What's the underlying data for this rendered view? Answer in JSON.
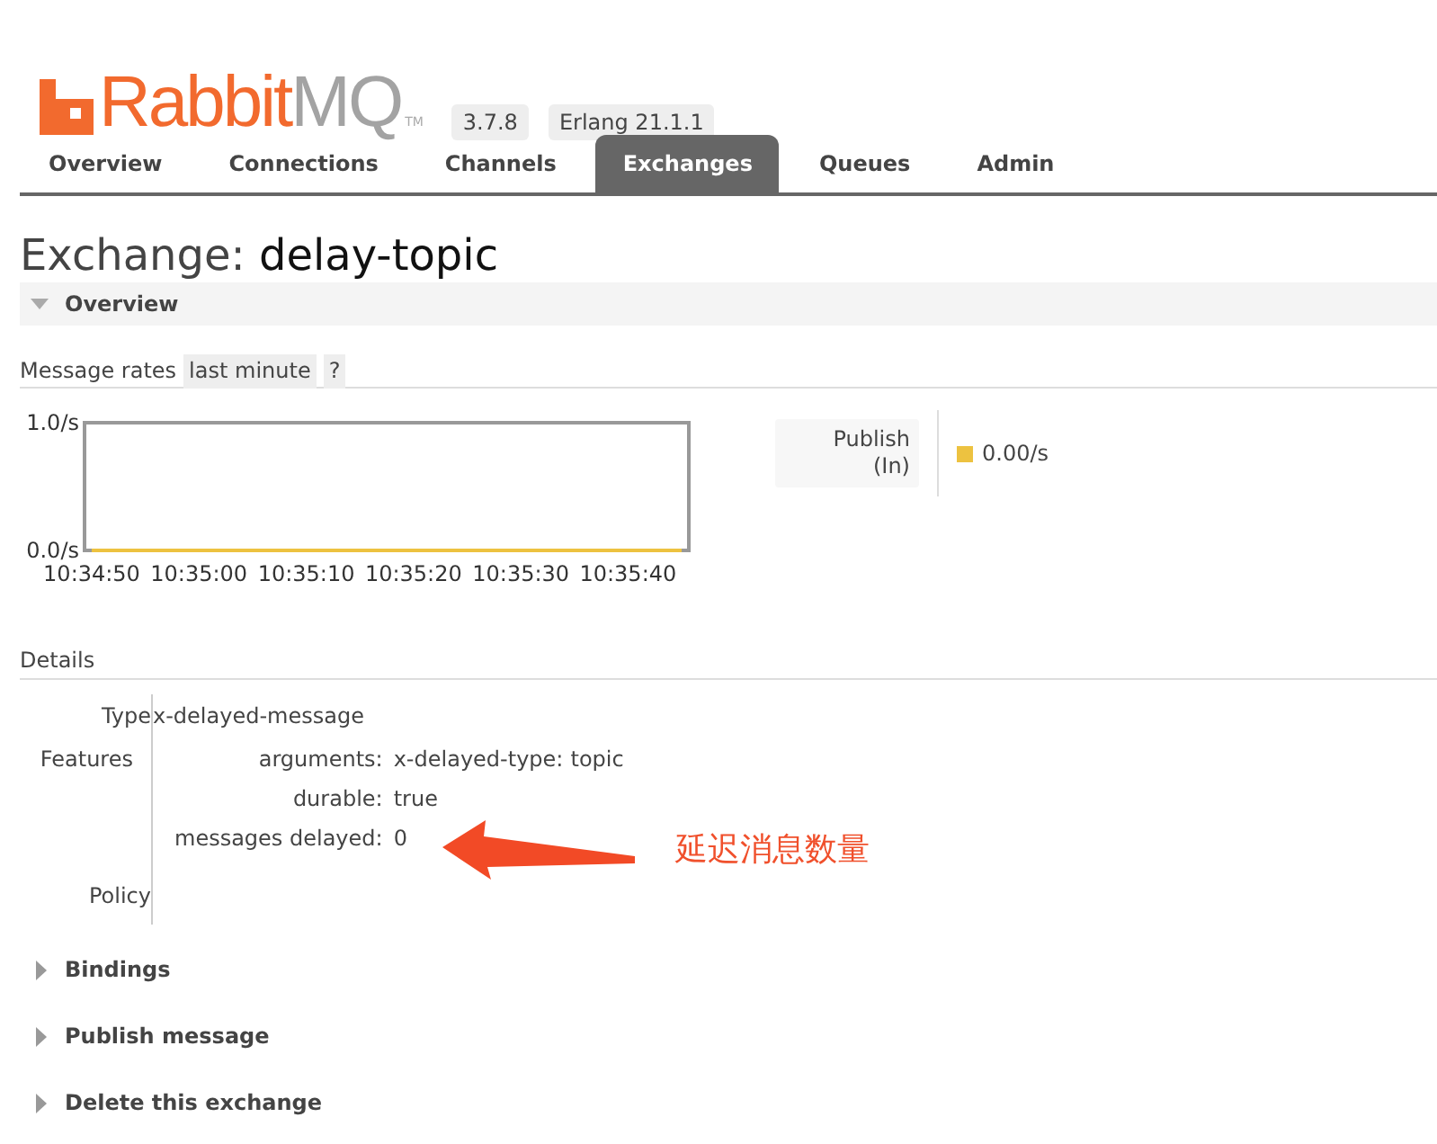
{
  "logo": {
    "name_start": "Rabbit",
    "name_end": "MQ",
    "trademark": "TM"
  },
  "versions": [
    "3.7.8",
    "Erlang 21.1.1"
  ],
  "tabs": [
    {
      "label": "Overview",
      "selected": false
    },
    {
      "label": "Connections",
      "selected": false
    },
    {
      "label": "Channels",
      "selected": false
    },
    {
      "label": "Exchanges",
      "selected": true
    },
    {
      "label": "Queues",
      "selected": false
    },
    {
      "label": "Admin",
      "selected": false
    }
  ],
  "page_title": {
    "label": "Exchange:",
    "name": "delay-topic"
  },
  "sections": [
    {
      "title": "Overview",
      "expanded": true,
      "message_rates": {
        "label": "Message rates",
        "range": "last minute",
        "help": "?",
        "chart_data": {
          "type": "line",
          "categories": [
            "10:34:50",
            null,
            "10:35:00",
            null,
            "10:35:10",
            null,
            "10:35:20",
            null,
            "10:35:30",
            null,
            "10:35:40",
            null
          ],
          "series": [
            {
              "name": "Publish (In)",
              "color": "#edc240",
              "values": [
                0,
                0,
                0,
                0,
                0,
                0,
                0,
                0,
                0,
                0,
                0,
                0
              ]
            }
          ],
          "ylim": [
            0,
            1
          ],
          "yticks": [
            {
              "value": 0,
              "label": "0.0/s"
            },
            {
              "value": 1,
              "label": "1.0/s"
            }
          ]
        },
        "current_rates": [
          "0.00/s"
        ]
      },
      "details": {
        "title": "Details",
        "rows": [
          {
            "label": "Type",
            "kind": "text",
            "value": "x-delayed-message"
          },
          {
            "label": "Features",
            "kind": "features",
            "features": [
              {
                "key": "arguments:",
                "kind": "args",
                "args": [
                  {
                    "key": "x-delayed-type:",
                    "value": "topic"
                  }
                ]
              },
              {
                "key": "durable:",
                "kind": "text",
                "value": "true"
              },
              {
                "key": "messages delayed:",
                "kind": "text",
                "value": "0",
                "annotation": "延迟消息数量"
              }
            ]
          },
          {
            "label": "Policy",
            "kind": "empty"
          }
        ]
      }
    },
    {
      "title": "Bindings",
      "expanded": false
    },
    {
      "title": "Publish message",
      "expanded": false
    },
    {
      "title": "Delete this exchange",
      "expanded": false
    }
  ]
}
